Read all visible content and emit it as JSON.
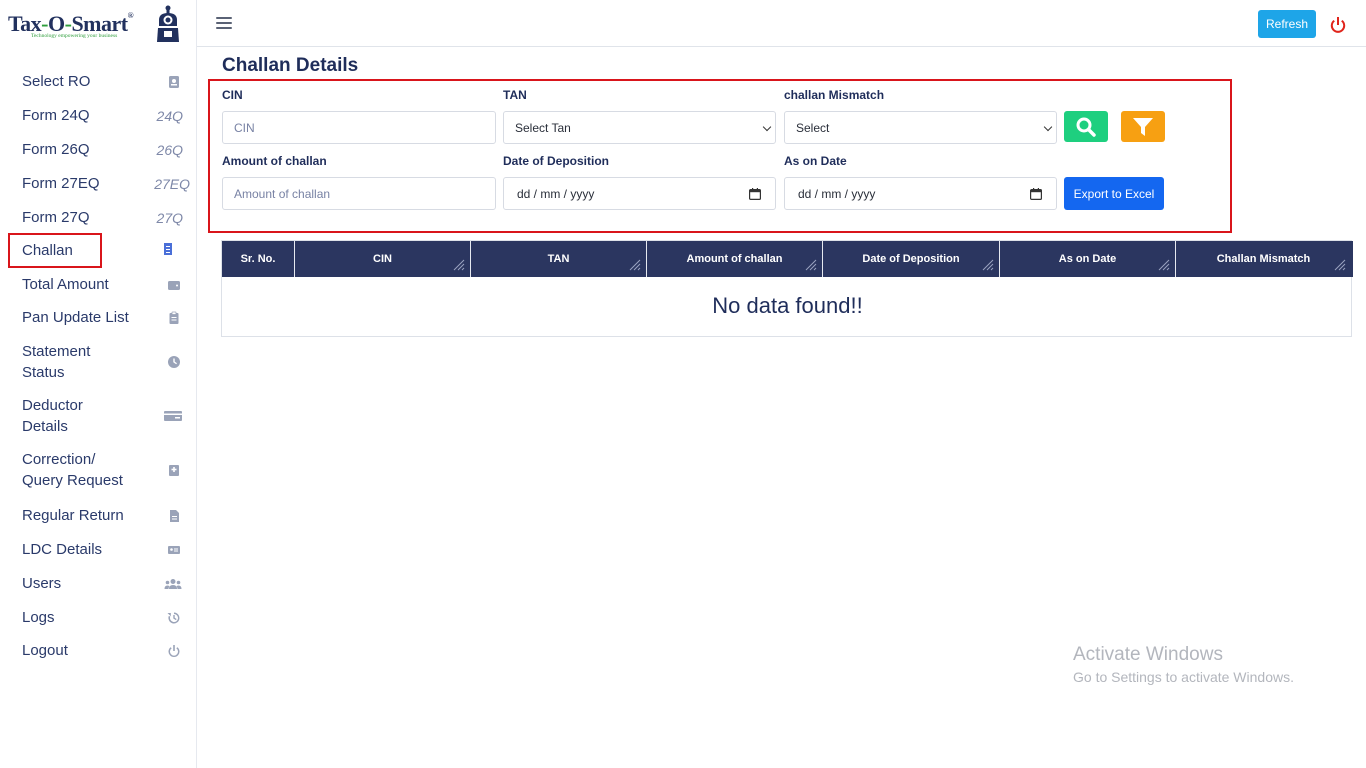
{
  "brand": {
    "name_part1": "Tax",
    "name_sep1": "-",
    "name_part2": "O",
    "name_sep2": "-",
    "name_part3": "Smart",
    "registered": "®",
    "tagline": "Technology empowering your business"
  },
  "sidebar": {
    "items": [
      {
        "label": "Select RO",
        "icon": "contact-book-icon"
      },
      {
        "label": "Form 24Q",
        "abbr": "24Q"
      },
      {
        "label": "Form 26Q",
        "abbr": "26Q"
      },
      {
        "label": "Form 27EQ",
        "abbr": "27EQ"
      },
      {
        "label": "Form 27Q",
        "abbr": "27Q"
      },
      {
        "label": "Challan",
        "icon": "receipt-icon",
        "active": true
      },
      {
        "label": "Total Amount",
        "icon": "wallet-icon"
      },
      {
        "label": "Pan Update List",
        "icon": "clipboard-icon"
      },
      {
        "label": "Statement\nStatus",
        "icon": "clock-icon"
      },
      {
        "label": "Deductor\nDetails",
        "icon": "card-icon"
      },
      {
        "label": "Correction/\nQuery Request",
        "icon": "hospital-icon"
      },
      {
        "label": "Regular Return",
        "icon": "file-icon"
      },
      {
        "label": "LDC Details",
        "icon": "id-card-icon"
      },
      {
        "label": "Users",
        "icon": "users-icon"
      },
      {
        "label": "Logs",
        "icon": "history-icon"
      },
      {
        "label": "Logout",
        "icon": "power-icon"
      }
    ]
  },
  "topbar": {
    "refresh_label": "Refresh"
  },
  "page": {
    "title": "Challan Details"
  },
  "filters": {
    "cin_label": "CIN",
    "cin_placeholder": "CIN",
    "tan_label": "TAN",
    "tan_value": "Select Tan",
    "mismatch_label": "challan Mismatch",
    "mismatch_value": "Select",
    "amount_label": "Amount of challan",
    "amount_placeholder": "Amount of challan",
    "deposition_label": "Date of Deposition",
    "deposition_value": "dd / mm / yyyy",
    "ason_label": "As on Date",
    "ason_value": "dd / mm / yyyy",
    "export_label": "Export to Excel"
  },
  "table": {
    "columns": [
      "Sr. No.",
      "CIN",
      "TAN",
      "Amount of challan",
      "Date of Deposition",
      "As on Date",
      "Challan Mismatch"
    ],
    "empty_message": "No data found!!"
  },
  "watermark": {
    "line1": "Activate Windows",
    "line2": "Go to Settings to activate Windows."
  },
  "colors": {
    "accent": "#1ea5e8",
    "primary_dark": "#2b3660",
    "search": "#1ecf7f",
    "filter": "#f7a012",
    "export": "#1467f0",
    "highlight": "#d9151b"
  }
}
